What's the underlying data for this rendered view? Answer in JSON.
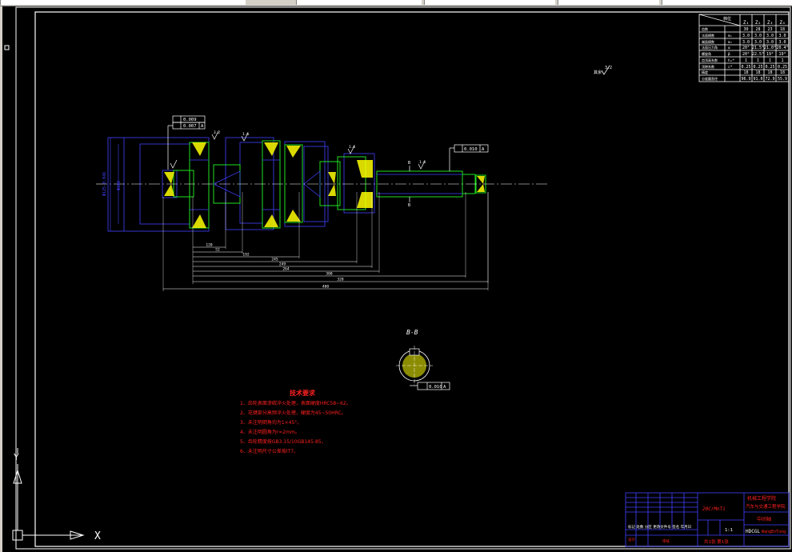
{
  "colors": {
    "background": "#000000",
    "outline": "#ffffff",
    "dimension": "#4040ff",
    "body": "#20e020",
    "hatch": "#ffff00",
    "centerline": "#ffffff",
    "notes": "#ff2020",
    "titleblock": "#4040ff"
  },
  "gear_table": {
    "header_mark": "档位",
    "columns": [
      "Z₁",
      "Z₂",
      "Z₃",
      "Z₄"
    ],
    "rows": [
      {
        "label": "齿数",
        "sym": "",
        "values": [
          "30",
          "28",
          "23",
          "18"
        ]
      },
      {
        "label": "法面模数",
        "sym": "mₙ",
        "values": [
          "3.0",
          "3.0",
          "3.0",
          "3.0"
        ]
      },
      {
        "label": "端面模数",
        "sym": "mₜ",
        "values": [
          "3.0",
          "3.0",
          "3.0",
          "3.0"
        ]
      },
      {
        "label": "法面压力角",
        "sym": "α",
        "values": [
          "20°",
          "21.5°",
          "21.0°",
          "20.4°"
        ]
      },
      {
        "label": "螺旋角",
        "sym": "β",
        "values": [
          "20°",
          "22.5°",
          "19°",
          "19°"
        ]
      },
      {
        "label": "齿顶高系数",
        "sym": "hₐ*",
        "values": [
          "1",
          "1",
          "1",
          "1"
        ]
      },
      {
        "label": "顶隙系数",
        "sym": "c*",
        "values": [
          "0.25",
          "0.25",
          "0.25",
          "0.25"
        ]
      },
      {
        "label": "精度",
        "sym": "",
        "values": [
          "18",
          "18",
          "18",
          "18"
        ]
      },
      {
        "label": "分度圆直径",
        "sym": "",
        "values": [
          "96.9",
          "91.0",
          "72.9",
          "55.9"
        ]
      }
    ]
  },
  "annotations": {
    "roughness_main": "3.2",
    "runout_1": "0.009",
    "runout_2": "0.007",
    "datum": "A",
    "runout_3": "0.010",
    "section_label": "B-B",
    "section_tol": "0.010",
    "roughness_a": "3.2",
    "roughness_b": "1.6",
    "roughness_c": "1.6",
    "roughness_d": "1.6",
    "cut_b": "B"
  },
  "dimensions": [
    "120",
    "52",
    "192",
    "245",
    "249",
    "264",
    "300",
    "328",
    "400"
  ],
  "notes": {
    "title": "技术要求",
    "items": [
      "1、齿轮表面渗碳淬火处理，表面硬度HRC58~62。",
      "2、花键部分高频淬火处理，硬度为45~50HRC。",
      "3、未注明倒角均为1×45°。",
      "4、未注明圆角为r=2mm。",
      "5、齿轮精度按GB3.15/10GB145-85，",
      "6、未注明尺寸公差按IT7。"
    ]
  },
  "title_block": {
    "part_name": "中间轴",
    "school": "机械工程学院",
    "project": "汽车与交通工程学院",
    "drawing_no": "HDCGL",
    "designer": "WangEnTong",
    "material": "20CrMnTi",
    "scale": "1:1",
    "sheet": "共1张  第1张"
  },
  "ucs": {
    "x_label": "X",
    "y_label": "Y"
  }
}
